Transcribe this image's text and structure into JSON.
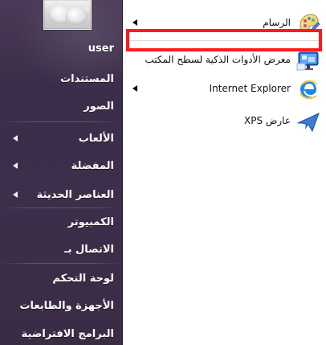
{
  "left_pane": {
    "user_label": "user",
    "items": [
      {
        "label": "المستندات",
        "has_arrow": false
      },
      {
        "label": "الصور",
        "has_arrow": false
      },
      {
        "label": "الألعاب",
        "has_arrow": true
      },
      {
        "label": "المفضلة",
        "has_arrow": true
      },
      {
        "label": "العناصر الحديثة",
        "has_arrow": true
      },
      {
        "label": "الكمبيوتر",
        "has_arrow": false
      },
      {
        "label": "الاتصال بـ",
        "has_arrow": false
      },
      {
        "label": "لوحة التحكم",
        "has_arrow": false
      },
      {
        "label": "الأجهزة والطابعات",
        "has_arrow": false
      },
      {
        "label": "البرامج الافتراضية",
        "has_arrow": false
      }
    ]
  },
  "right_pane": {
    "items": [
      {
        "label": "الرسام",
        "icon": "paint-icon",
        "has_arrow": true
      },
      {
        "label": "معرض الأدوات الذكية لسطح المكتب",
        "icon": "gadgets-icon",
        "has_arrow": false
      },
      {
        "label": "Internet Explorer",
        "icon": "internet-explorer-icon",
        "has_arrow": true
      },
      {
        "label": "عارض XPS",
        "icon": "xps-viewer-icon",
        "has_arrow": false
      }
    ]
  },
  "colors": {
    "highlight_red": "#ff1a1a",
    "left_bg": "#3b2d49",
    "right_bg": "#ffffff"
  }
}
